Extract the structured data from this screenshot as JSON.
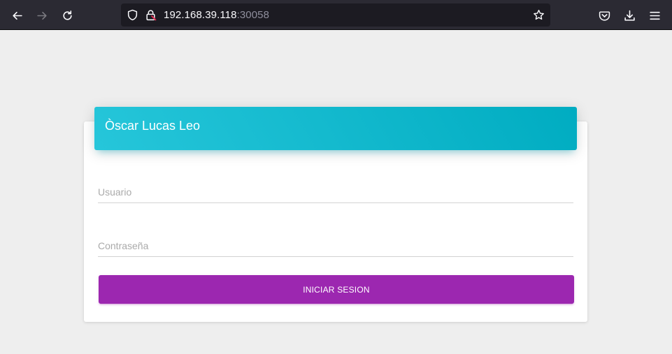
{
  "browser": {
    "url_host": "192.168.39.118",
    "url_port": ":30058",
    "icons": [
      "back-arrow-icon",
      "forward-arrow-icon",
      "reload-icon",
      "shield-icon",
      "lock-icon",
      "star-icon",
      "pocket-icon",
      "download-icon",
      "menu-icon"
    ]
  },
  "login": {
    "title": "Òscar Lucas Leo",
    "username_placeholder": "Usuario",
    "password_placeholder": "Contraseña",
    "submit_label": "INICIAR SESION"
  },
  "colors": {
    "header_gradient_start": "#26c6da",
    "header_gradient_end": "#00acc1",
    "button": "#9c27b0",
    "page_bg": "#eeeeee",
    "toolbar_bg": "#2b2a33"
  }
}
